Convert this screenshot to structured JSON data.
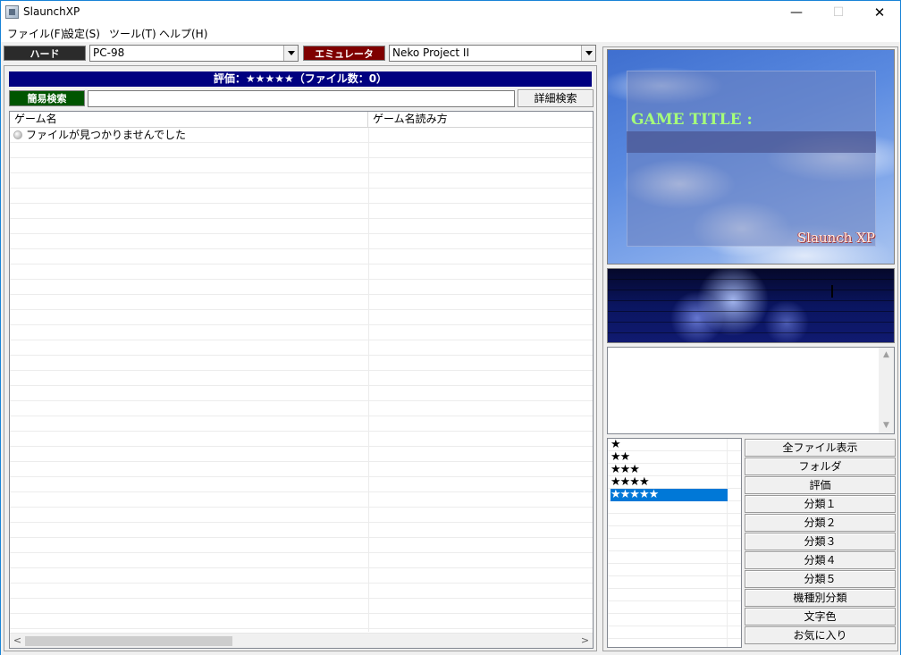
{
  "window": {
    "title": "SlaunchXP",
    "minimize": "—",
    "maximize": "☐",
    "close": "✕"
  },
  "menu": [
    "ファイル(F)",
    "設定(S)",
    "ツール(T)",
    "ヘルプ(H)"
  ],
  "hard": {
    "label": "ハード",
    "value": "PC-98"
  },
  "emulator": {
    "label": "エミュレータ",
    "value": "Neko Project II"
  },
  "rating_bar": "評価：★★★★★（ファイル数：0）",
  "search": {
    "label": "簡易検索",
    "value": "",
    "detail_button": "詳細検索"
  },
  "game_list": {
    "columns": [
      "ゲーム名",
      "ゲーム名読み方"
    ],
    "rows": [
      {
        "name": "ファイルが見つかりませんでした",
        "reading": ""
      }
    ],
    "scroll_left": "<",
    "scroll_right": ">"
  },
  "preview": {
    "game_title_label": "GAME TITLE :",
    "game_title_value": "",
    "logo": "Slaunch XP"
  },
  "memo": {
    "text": "",
    "scroll_up": "▲",
    "scroll_down": "▼"
  },
  "rating_list": {
    "items": [
      "★",
      "★★",
      "★★★",
      "★★★★",
      "★★★★★"
    ],
    "selected_index": 4
  },
  "side_buttons": [
    "全ファイル表示",
    "フォルダ",
    "評価",
    "分類１",
    "分類２",
    "分類３",
    "分類４",
    "分類５",
    "機種別分類",
    "文字色",
    "お気に入り"
  ],
  "colors": {
    "window_border": "#1883d7",
    "rating_bar_bg": "#000080",
    "hard_label_bg": "#2b2b2b",
    "emulator_label_bg": "#7f0000",
    "search_label_bg": "#005500",
    "selection": "#0078d7",
    "game_title_text": "#a6ff7a"
  }
}
